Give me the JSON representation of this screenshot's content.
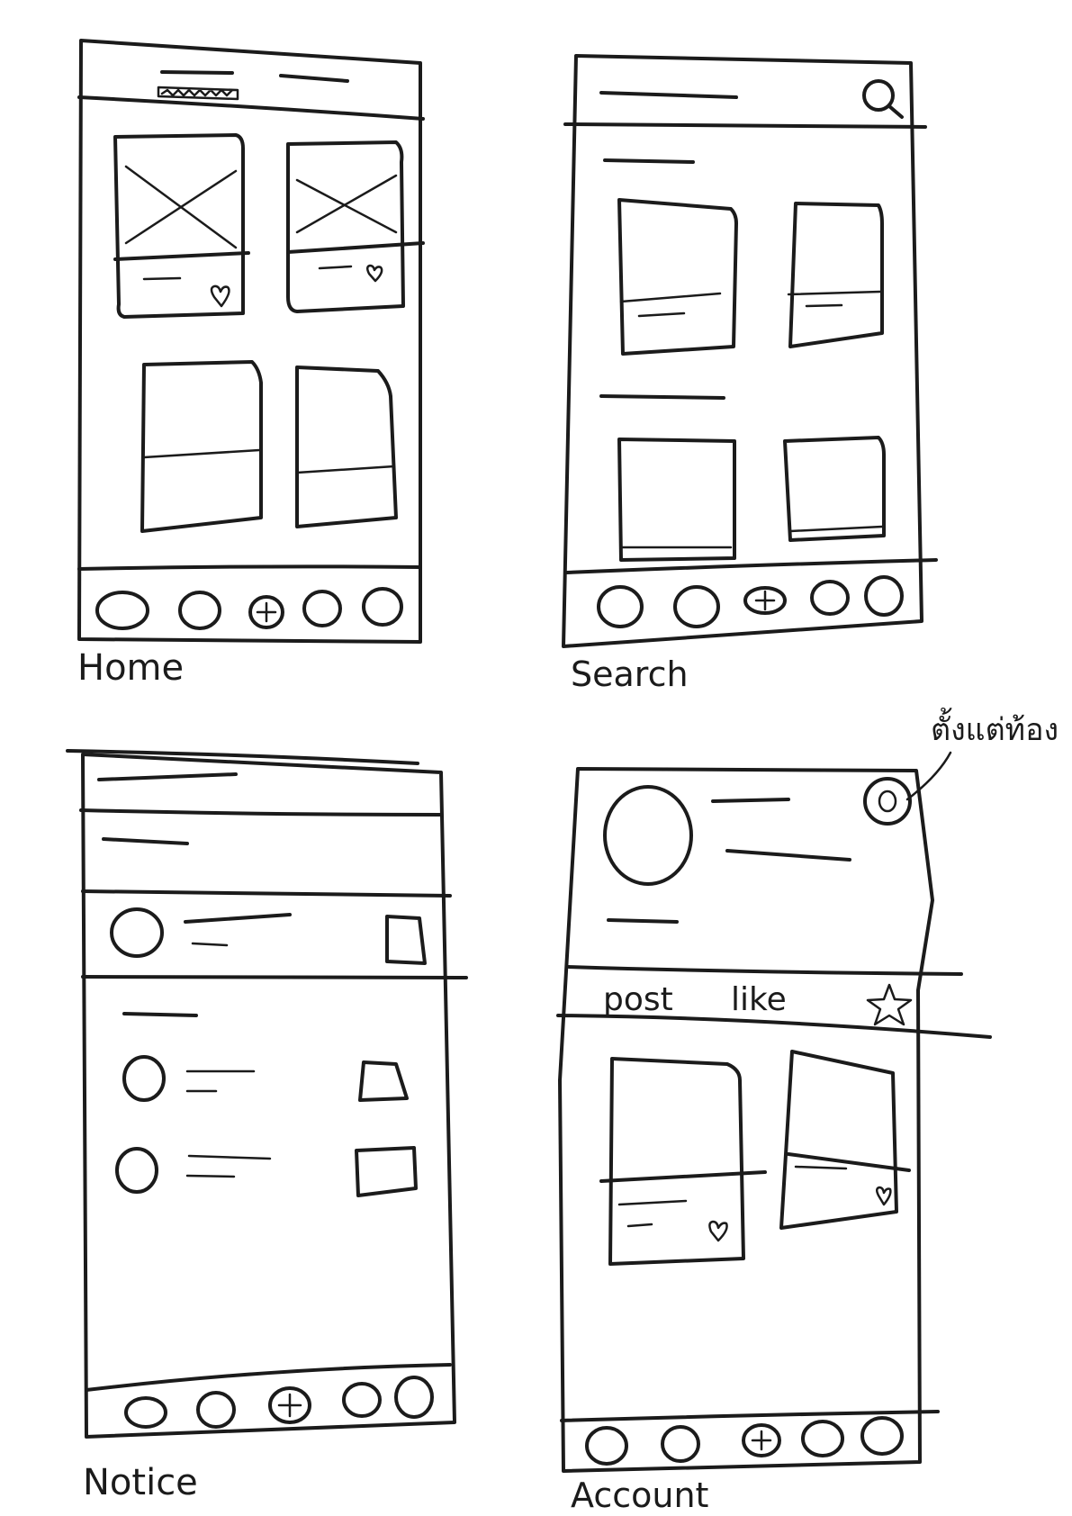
{
  "screens": {
    "home": {
      "caption": "Home"
    },
    "search": {
      "caption": "Search"
    },
    "notice": {
      "caption": "Notice"
    },
    "account": {
      "caption": "Account",
      "tabs": {
        "post": "post",
        "like": "like"
      },
      "settings_note": "ตั้งแต่ท้อง"
    }
  },
  "icons": {
    "like": "heart-icon",
    "search": "search-icon",
    "add": "plus-icon",
    "favorite": "star-icon",
    "settings": "settings-icon"
  }
}
